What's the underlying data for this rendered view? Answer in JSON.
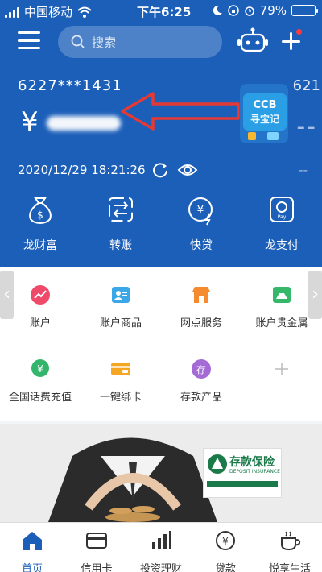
{
  "status_bar": {
    "carrier": "中国移动",
    "time": "下午6:25",
    "battery": "79%",
    "battery_level": 0.79
  },
  "header": {
    "search_placeholder": "搜索"
  },
  "account_card": {
    "account_number": "6227***1431",
    "currency_symbol": "¥",
    "updated_at": "2020/12/29 18:21:26",
    "right_partial_number": "621",
    "right_balance_placeholder": "--",
    "right_extra_placeholder": "-- ",
    "promo_label": "CCB 寻宝记"
  },
  "quick_actions": [
    {
      "label": "龙财富",
      "icon": "money-bag-icon"
    },
    {
      "label": "转账",
      "icon": "transfer-icon"
    },
    {
      "label": "快贷",
      "icon": "quick-loan-icon"
    },
    {
      "label": "龙支付",
      "icon": "pay-icon"
    }
  ],
  "menu_grid": {
    "row1": [
      {
        "label": "账户",
        "icon": "account-chart-icon",
        "color": "#f04a6b"
      },
      {
        "label": "账户商品",
        "icon": "account-goods-icon",
        "color": "#3aa8e6"
      },
      {
        "label": "网点服务",
        "icon": "branch-store-icon",
        "color": "#f58a2f"
      },
      {
        "label": "账户贵金属",
        "icon": "precious-metal-icon",
        "color": "#35b86a"
      }
    ],
    "row2": [
      {
        "label": "全国话费充值",
        "icon": "phone-topup-icon",
        "color": "#33b56b"
      },
      {
        "label": "一键绑卡",
        "icon": "bind-card-icon",
        "color": "#f5a623"
      },
      {
        "label": "存款产品",
        "icon": "deposit-icon",
        "color": "#a46ad6"
      },
      {
        "label": "",
        "icon": "add-more-icon",
        "color": "#bbbbbb"
      }
    ]
  },
  "banner": {
    "badge_title": "存款保险",
    "badge_subtitle": "DEPOSIT INSURANCE"
  },
  "tabbar": [
    {
      "label": "首页",
      "icon": "home-icon",
      "active": true
    },
    {
      "label": "信用卡",
      "icon": "credit-card-icon",
      "active": false
    },
    {
      "label": "投资理财",
      "icon": "investment-icon",
      "active": false
    },
    {
      "label": "贷款",
      "icon": "loan-icon",
      "active": false
    },
    {
      "label": "悦享生活",
      "icon": "coffee-cup-icon",
      "active": false
    }
  ],
  "colors": {
    "brand_blue": "#1c5fb9",
    "annotation_red": "#e53935"
  }
}
